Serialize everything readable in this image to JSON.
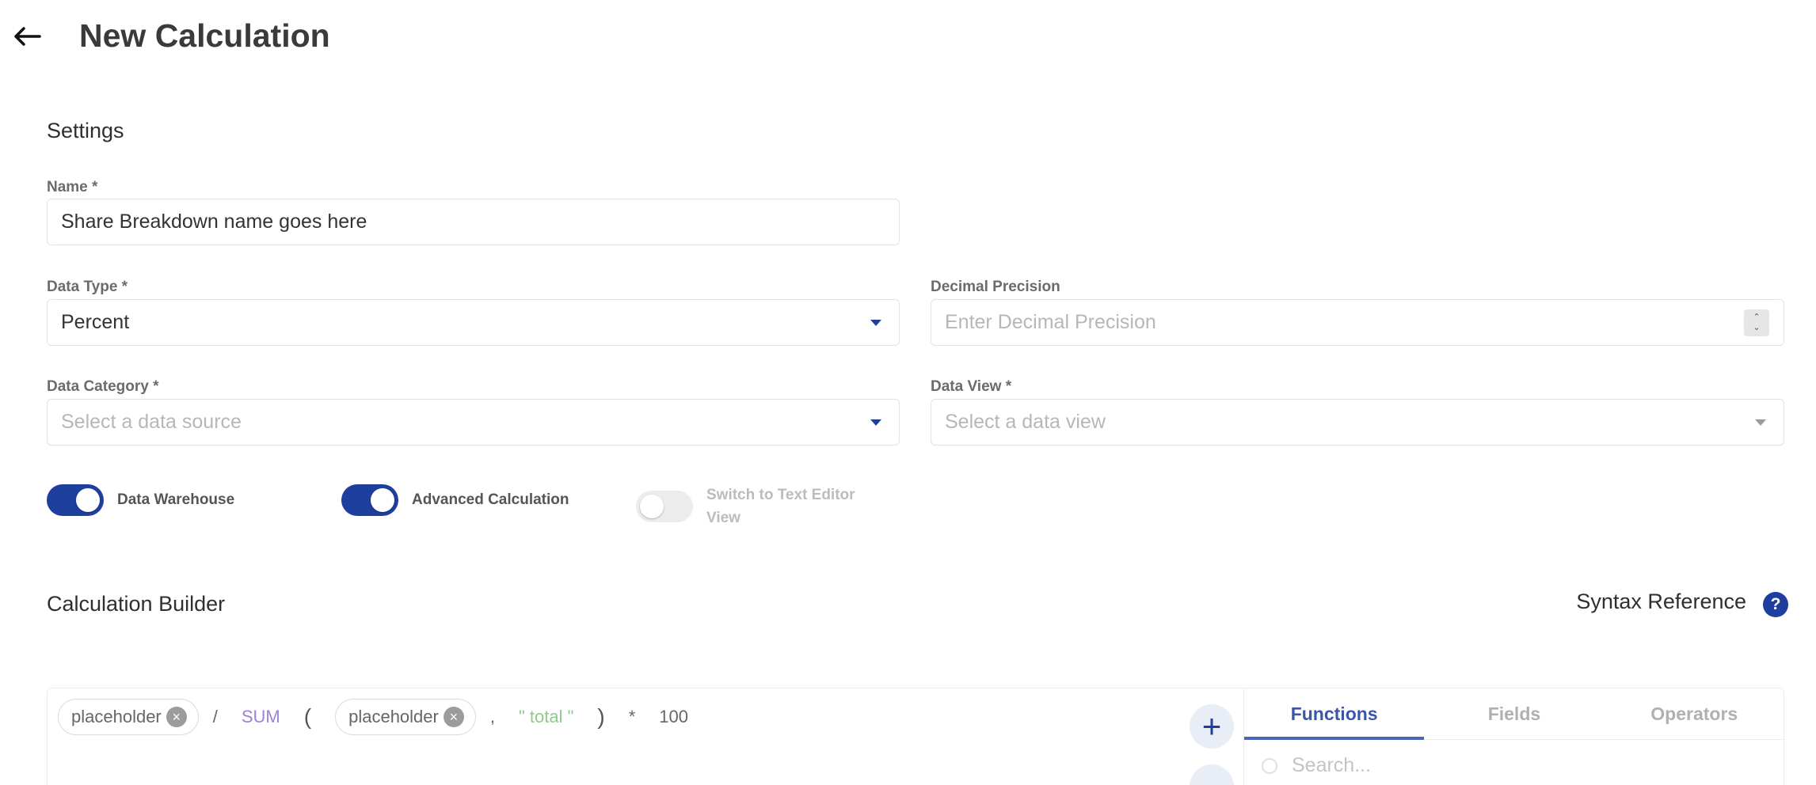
{
  "header": {
    "title": "New Calculation"
  },
  "settings": {
    "title": "Settings",
    "name": {
      "label": "Name *",
      "value": "Share Breakdown name goes here"
    },
    "data_type": {
      "label": "Data Type *",
      "value": "Percent"
    },
    "decimal_precision": {
      "label": "Decimal Precision",
      "placeholder": "Enter Decimal Precision"
    },
    "data_category": {
      "label": "Data Category *",
      "placeholder": "Select a data source"
    },
    "data_view": {
      "label": "Data View *",
      "placeholder": "Select a data view"
    }
  },
  "toggles": {
    "data_warehouse": {
      "label": "Data Warehouse",
      "on": true
    },
    "advanced_calculation": {
      "label": "Advanced Calculation",
      "on": true
    },
    "text_editor": {
      "label_line1": "Switch to Text Editor",
      "label_line2": "View",
      "on": false,
      "disabled": true
    }
  },
  "builder": {
    "title": "Calculation Builder",
    "syntax_reference": "Syntax Reference",
    "formula": {
      "chip1": "placeholder",
      "divide": "/",
      "fn": "SUM",
      "open_paren": "(",
      "chip2": "placeholder",
      "comma": ",",
      "string": "\" total \"",
      "close_paren": ")",
      "multiply": "*",
      "number": "100"
    },
    "tabs": [
      "Functions",
      "Fields",
      "Operators"
    ],
    "active_tab": "Functions",
    "search_placeholder": "Search..."
  },
  "colors": {
    "accent": "#1e3f9e",
    "function_token": "#9a84d6",
    "string_token": "#8fc98f"
  }
}
